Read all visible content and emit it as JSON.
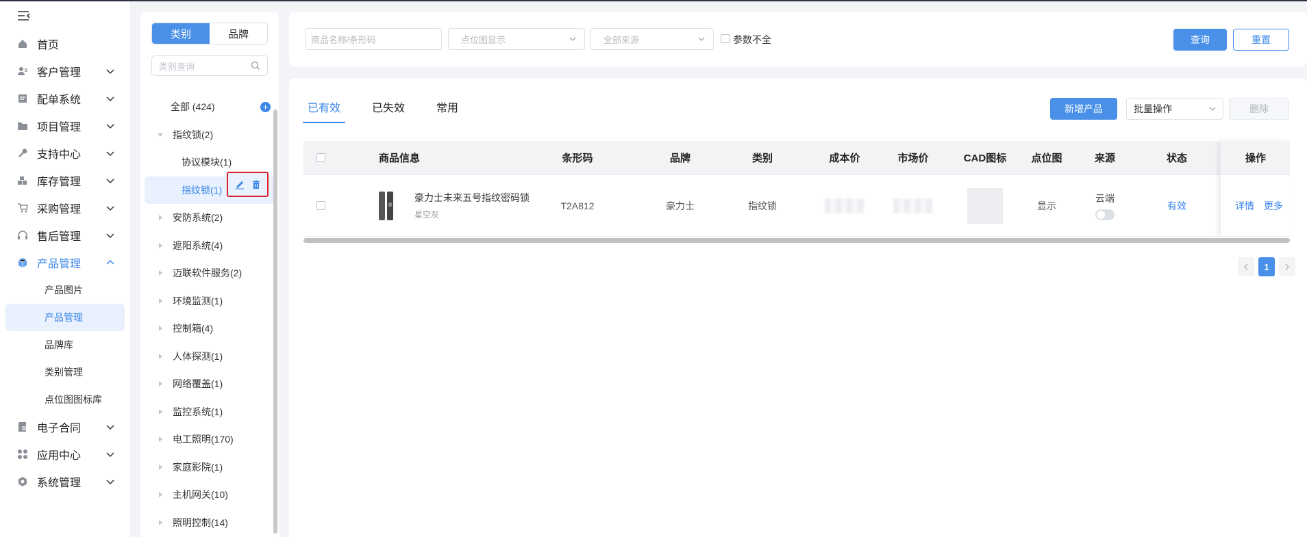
{
  "sidebar": {
    "menu": [
      {
        "label": "首页",
        "icon": "home-icon",
        "expandable": false
      },
      {
        "label": "客户管理",
        "icon": "customer-icon",
        "expandable": true
      },
      {
        "label": "配单系统",
        "icon": "order-icon",
        "expandable": true
      },
      {
        "label": "项目管理",
        "icon": "folder-icon",
        "expandable": true
      },
      {
        "label": "支持中心",
        "icon": "wrench-icon",
        "expandable": true
      },
      {
        "label": "库存管理",
        "icon": "inventory-icon",
        "expandable": true
      },
      {
        "label": "采购管理",
        "icon": "cart-icon",
        "expandable": true
      },
      {
        "label": "售后管理",
        "icon": "headset-icon",
        "expandable": true
      },
      {
        "label": "产品管理",
        "icon": "cube-icon",
        "expandable": true,
        "expanded": true
      }
    ],
    "product_submenu": [
      "产品图片",
      "产品管理",
      "品牌库",
      "类别管理",
      "点位图图标库"
    ],
    "menu_after": [
      {
        "label": "电子合同",
        "icon": "contract-icon"
      },
      {
        "label": "应用中心",
        "icon": "apps-icon"
      },
      {
        "label": "系统管理",
        "icon": "settings-icon"
      }
    ]
  },
  "category_panel": {
    "seg_category": "类别",
    "seg_brand": "品牌",
    "search_placeholder": "类别查询",
    "all_label": "全部 (424)",
    "nodes": [
      {
        "label": "指纹锁(2)",
        "level": 1,
        "expanded": true
      },
      {
        "label": "协议模块(1)",
        "level": 2
      },
      {
        "label": "指纹锁(1)",
        "level": 2,
        "selected": true
      },
      {
        "label": "安防系统(2)",
        "level": 1
      },
      {
        "label": "遮阳系统(4)",
        "level": 1
      },
      {
        "label": "迈联软件服务(2)",
        "level": 1
      },
      {
        "label": "环境监测(1)",
        "level": 1
      },
      {
        "label": "控制箱(4)",
        "level": 1
      },
      {
        "label": "人体探测(1)",
        "level": 1
      },
      {
        "label": "网络覆盖(1)",
        "level": 1
      },
      {
        "label": "监控系统(1)",
        "level": 1
      },
      {
        "label": "电工照明(170)",
        "level": 1
      },
      {
        "label": "家庭影院(1)",
        "level": 1
      },
      {
        "label": "主机网关(10)",
        "level": 1
      },
      {
        "label": "照明控制(14)",
        "level": 1
      }
    ]
  },
  "filters": {
    "name_placeholder": "商品名称/条形码",
    "point_select": "点位图显示",
    "source_select": "全部来源",
    "incomplete_label": "参数不全",
    "query": "查询",
    "reset": "重置"
  },
  "main": {
    "tabs": [
      "已有效",
      "已失效",
      "常用"
    ],
    "add_button": "新增产品",
    "batch_select": "批量操作",
    "delete_button": "删除",
    "columns": [
      "商品信息",
      "条形码",
      "品牌",
      "类别",
      "成本价",
      "市场价",
      "CAD图标",
      "点位图",
      "来源",
      "状态",
      "操作"
    ],
    "rows": [
      {
        "name": "豪力士未来五号指纹密码锁",
        "variant": "星空灰",
        "barcode": "T2A812",
        "brand": "豪力士",
        "category": "指纹锁",
        "point_map": "显示",
        "source": "云端",
        "status": "有效",
        "action_detail": "详情",
        "action_more": "更多"
      }
    ],
    "pagination": {
      "current": "1"
    }
  },
  "colors": {
    "accent": "#4a90e8",
    "highlight_border": "#e0212b"
  }
}
